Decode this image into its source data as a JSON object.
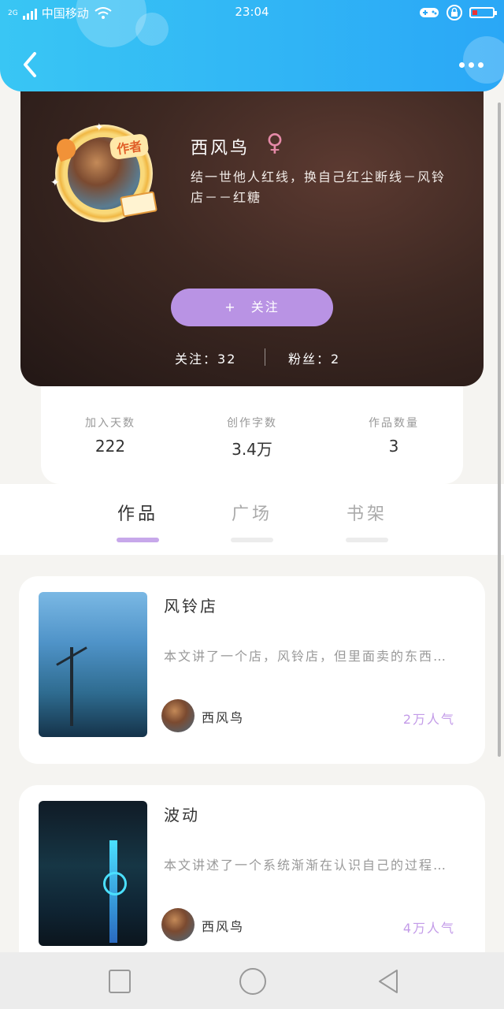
{
  "status_bar": {
    "network": "2G",
    "carrier": "中国移动",
    "time": "23:04"
  },
  "header": {
    "back_icon": "chevron-left-icon",
    "more_icon": "more-dots-icon"
  },
  "profile": {
    "name": "西风鸟",
    "gender_symbol": "♀",
    "author_tag": "作者",
    "bio": "结一世他人红线，换自己红尘断线－风铃店－－红糖",
    "follow_button": "+　关注",
    "following_label": "关注：",
    "following_count": "32",
    "fans_label": "粉丝：",
    "fans_count": "2"
  },
  "stats": [
    {
      "label": "加入天数",
      "value": "222"
    },
    {
      "label": "创作字数",
      "value": "3.4万"
    },
    {
      "label": "作品数量",
      "value": "3"
    }
  ],
  "tabs": [
    {
      "label": "作品",
      "active": true
    },
    {
      "label": "广场",
      "active": false
    },
    {
      "label": "书架",
      "active": false
    }
  ],
  "works": [
    {
      "title": "风铃店",
      "description": "本文讲了一个店，风铃店，但里面卖的东西……",
      "author": "西风鸟",
      "popularity": "2万人气"
    },
    {
      "title": "波动",
      "description": "本文讲述了一个系统渐渐在认识自己的过程……",
      "author": "西风鸟",
      "popularity": "4万人气"
    }
  ],
  "colors": {
    "header_blue": "#2aa7f6",
    "accent_purple": "#b993e4",
    "popularity_purple": "#c39be8",
    "gender_pink": "#e58aa8"
  }
}
